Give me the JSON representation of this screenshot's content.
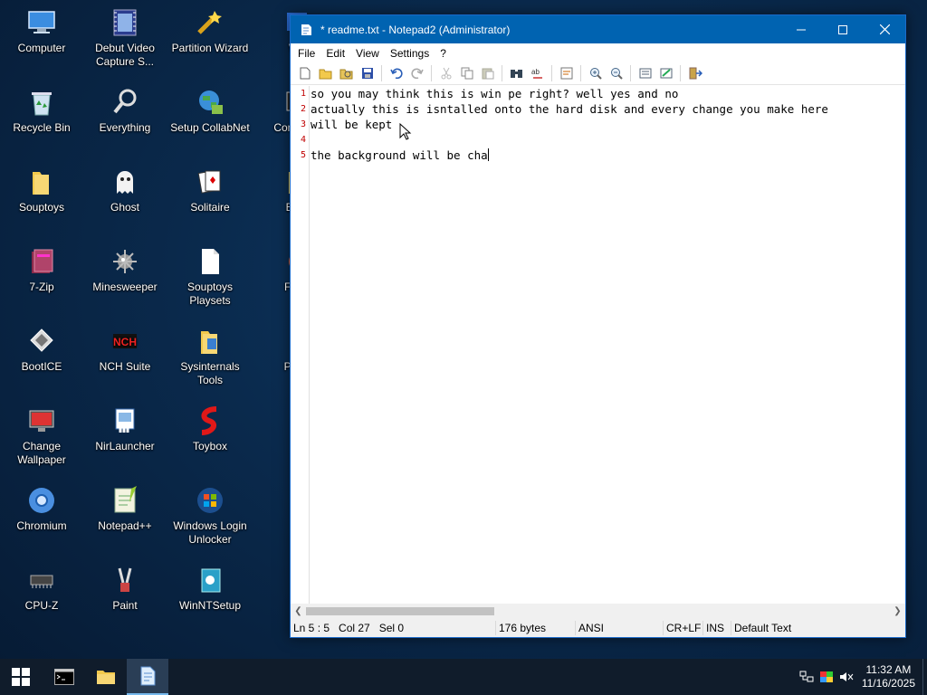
{
  "desktop": {
    "icons": [
      {
        "label": "Computer",
        "icon": "computer-icon"
      },
      {
        "label": "Debut Video Capture S...",
        "icon": "video-capture-icon"
      },
      {
        "label": "Partition Wizard",
        "icon": "partition-wizard-icon"
      },
      {
        "label": "Wi",
        "icon": "app-icon"
      },
      {
        "label": "Recycle Bin",
        "icon": "recycle-bin-icon"
      },
      {
        "label": "Everything",
        "icon": "search-magnifier-icon"
      },
      {
        "label": "Setup CollabNet",
        "icon": "globe-icon"
      },
      {
        "label": "Com Pro",
        "icon": "app-icon"
      },
      {
        "label": "Souptoys",
        "icon": "folder-icon"
      },
      {
        "label": "Ghost",
        "icon": "ghost-icon"
      },
      {
        "label": "Solitaire",
        "icon": "cards-icon"
      },
      {
        "label": "Exp",
        "icon": "folder-icon"
      },
      {
        "label": "7-Zip",
        "icon": "archive-icon"
      },
      {
        "label": "Minesweeper",
        "icon": "mine-icon"
      },
      {
        "label": "Souptoys Playsets",
        "icon": "document-icon"
      },
      {
        "label": "Firef",
        "icon": "firefox-icon"
      },
      {
        "label": "BootICE",
        "icon": "bootice-icon"
      },
      {
        "label": "NCH Suite",
        "icon": "nch-icon"
      },
      {
        "label": "Sysinternals Tools",
        "icon": "folder-icon"
      },
      {
        "label": "PEN",
        "icon": "app-icon"
      },
      {
        "label": "Change Wallpaper",
        "icon": "wallpaper-icon"
      },
      {
        "label": "NirLauncher",
        "icon": "nirlauncher-icon"
      },
      {
        "label": "Toybox",
        "icon": "toybox-icon"
      },
      {
        "label": "Chromium",
        "icon": "chromium-icon"
      },
      {
        "label": "Notepad++",
        "icon": "notepadpp-icon"
      },
      {
        "label": "Windows Login Unlocker",
        "icon": "windows-icon"
      },
      {
        "label": "CPU-Z",
        "icon": "chip-icon"
      },
      {
        "label": "Paint",
        "icon": "paint-icon"
      },
      {
        "label": "WinNTSetup",
        "icon": "setup-icon"
      }
    ]
  },
  "window": {
    "title": "* readme.txt - Notepad2 (Administrator)",
    "menu": [
      "File",
      "Edit",
      "View",
      "Settings",
      "?"
    ],
    "toolbar_icons": [
      "new-icon",
      "open-icon",
      "browse-icon",
      "save-icon",
      "undo-icon",
      "redo-icon",
      "cut-icon",
      "copy-icon",
      "paste-icon",
      "find-icon",
      "replace-icon",
      "wordwrap-icon",
      "zoom-in-icon",
      "zoom-out-icon",
      "scheme-icon",
      "customize-icon",
      "exit-icon"
    ],
    "line_numbers": [
      "1",
      "2",
      "3",
      "4",
      "5"
    ],
    "lines": [
      "so you may think this is win pe right? well yes and no",
      "actually this is isntalled onto the hard disk and every change you make here",
      "will be kept",
      "",
      "the background will be cha"
    ],
    "status": {
      "position": "Ln 5 : 5   Col 27   Sel 0",
      "size": "176 bytes",
      "encoding": "ANSI",
      "eol": "CR+LF",
      "mode": "INS",
      "scheme": "Default Text"
    }
  },
  "taskbar": {
    "time": "11:32 AM",
    "date": "11/16/2025"
  },
  "colors": {
    "titlebar": "#0063b1",
    "taskbar": "#101c2b",
    "line_number": "#c00000"
  }
}
